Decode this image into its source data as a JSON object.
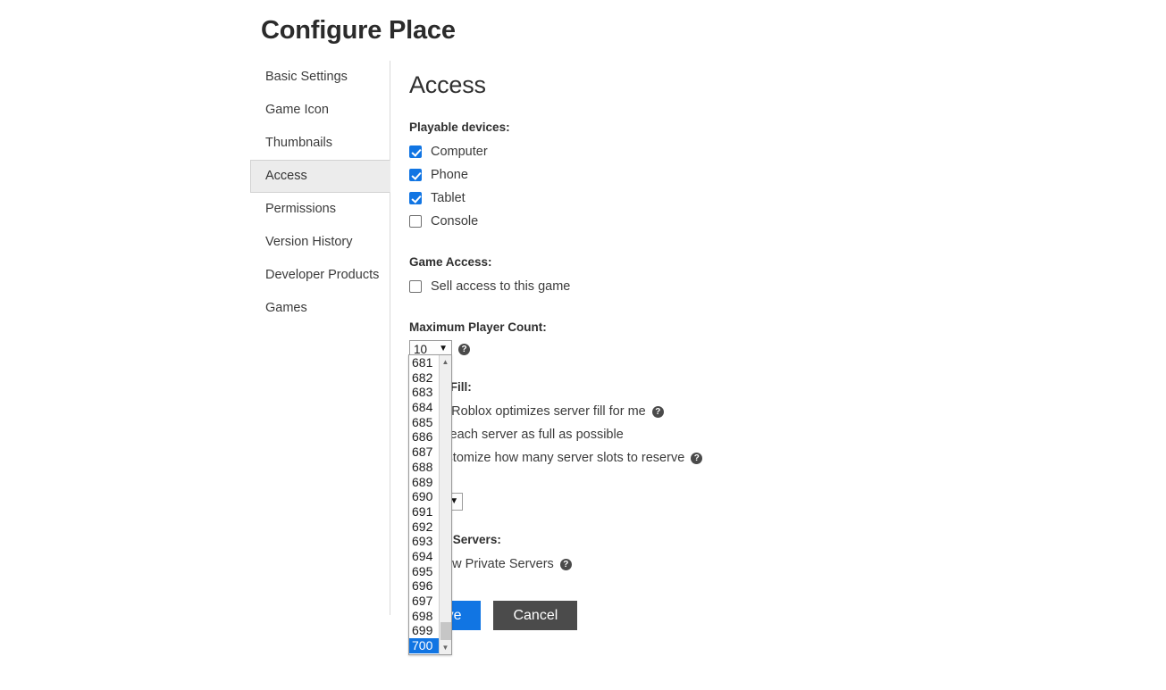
{
  "page": {
    "title": "Configure Place"
  },
  "sidebar": {
    "items": [
      {
        "label": "Basic Settings",
        "active": false
      },
      {
        "label": "Game Icon",
        "active": false
      },
      {
        "label": "Thumbnails",
        "active": false
      },
      {
        "label": "Access",
        "active": true
      },
      {
        "label": "Permissions",
        "active": false
      },
      {
        "label": "Version History",
        "active": false
      },
      {
        "label": "Developer Products",
        "active": false
      },
      {
        "label": "Games",
        "active": false
      }
    ]
  },
  "main": {
    "heading": "Access",
    "playable_devices": {
      "label": "Playable devices:",
      "options": [
        {
          "label": "Computer",
          "checked": true
        },
        {
          "label": "Phone",
          "checked": true
        },
        {
          "label": "Tablet",
          "checked": true
        },
        {
          "label": "Console",
          "checked": false
        }
      ]
    },
    "game_access": {
      "label": "Game Access:",
      "options": [
        {
          "label": "Sell access to this game",
          "checked": false
        }
      ]
    },
    "max_player_count": {
      "label": "Maximum Player Count:",
      "value": "10",
      "help_icon": "help-icon",
      "chevron": "chevron-down-icon"
    },
    "server_fill": {
      "label": "Server Fill:",
      "options": [
        {
          "label": "Let Roblox optimizes server fill for me",
          "selected": true,
          "help": true
        },
        {
          "label": "Fill each server as full as possible",
          "selected": false,
          "help": false
        },
        {
          "label": "Customize how many server slots to reserve",
          "selected": false,
          "help": true
        }
      ],
      "reserve_select_value": "None"
    },
    "private_servers": {
      "label": "Private Servers:",
      "options": [
        {
          "label": "Allow Private Servers",
          "checked": false,
          "help": true
        }
      ]
    },
    "buttons": {
      "save": "Save",
      "cancel": "Cancel"
    }
  },
  "dropdown": {
    "open": true,
    "selected_value": "700",
    "scroll_up_icon": "scroll-up-arrow-icon",
    "scroll_down_icon": "scroll-down-arrow-icon",
    "visible_options": [
      "681",
      "682",
      "683",
      "684",
      "685",
      "686",
      "687",
      "688",
      "689",
      "690",
      "691",
      "692",
      "693",
      "694",
      "695",
      "696",
      "697",
      "698",
      "699",
      "700"
    ]
  },
  "colors": {
    "accent_blue": "#1175e3",
    "cancel_gray": "#4b4b4b",
    "active_nav_bg": "#ececec"
  }
}
